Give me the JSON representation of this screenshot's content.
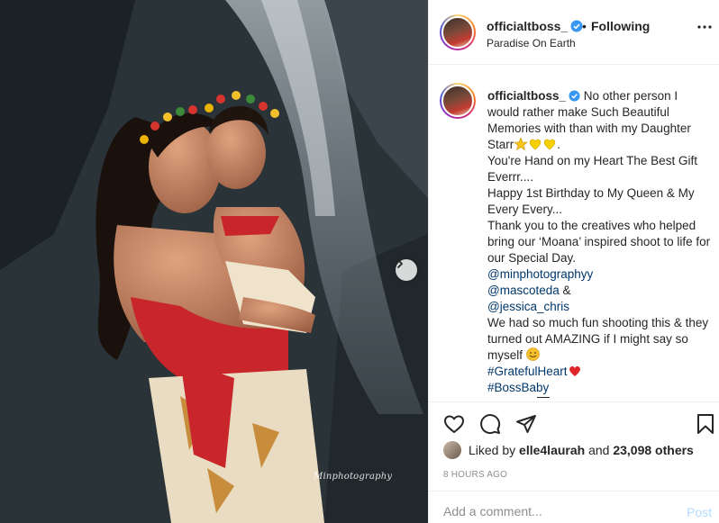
{
  "post": {
    "username": "officialtboss_",
    "follow_status": "Following",
    "separator": "•",
    "location": "Paradise On Earth",
    "watermark": "Minphotography"
  },
  "caption": {
    "username": "officialtboss_",
    "line1": " No other person I would rather make Such Beautiful Memories with than with my Daughter Starr",
    "line1_end": ".",
    "line2": "You're Hand on my Heart The Best Gift Everrr....",
    "line3": "Happy 1st Birthday to My Queen & My Every Every...",
    "line4": "Thank you to the creatives who helped bring our ‘Moana’ inspired shoot to life for our Special Day.",
    "mention1": "@minphotographyy",
    "mention2": "@mascoteda",
    "amp": " &",
    "mention3": "@jessica_chris",
    "line5": "We had so much fun shooting this & they turned out AMAZING if I might say so myself ",
    "tag1": "#GratefulHeart",
    "tag2": "#BossBaby"
  },
  "likes": {
    "prefix": "Liked by ",
    "user": "elle4laurah",
    "middle": " and ",
    "count": "23,098 others"
  },
  "timestamp": "8 HOURS AGO",
  "comment": {
    "placeholder": "Add a comment...",
    "post_label": "Post"
  },
  "colors": {
    "link": "#00376b",
    "verified": "#3897f0",
    "post_disabled": "#b3dbff"
  },
  "icons": [
    "heart-icon",
    "comment-icon",
    "share-icon",
    "bookmark-icon",
    "more-icon",
    "verified-icon",
    "chevron-right-icon"
  ]
}
